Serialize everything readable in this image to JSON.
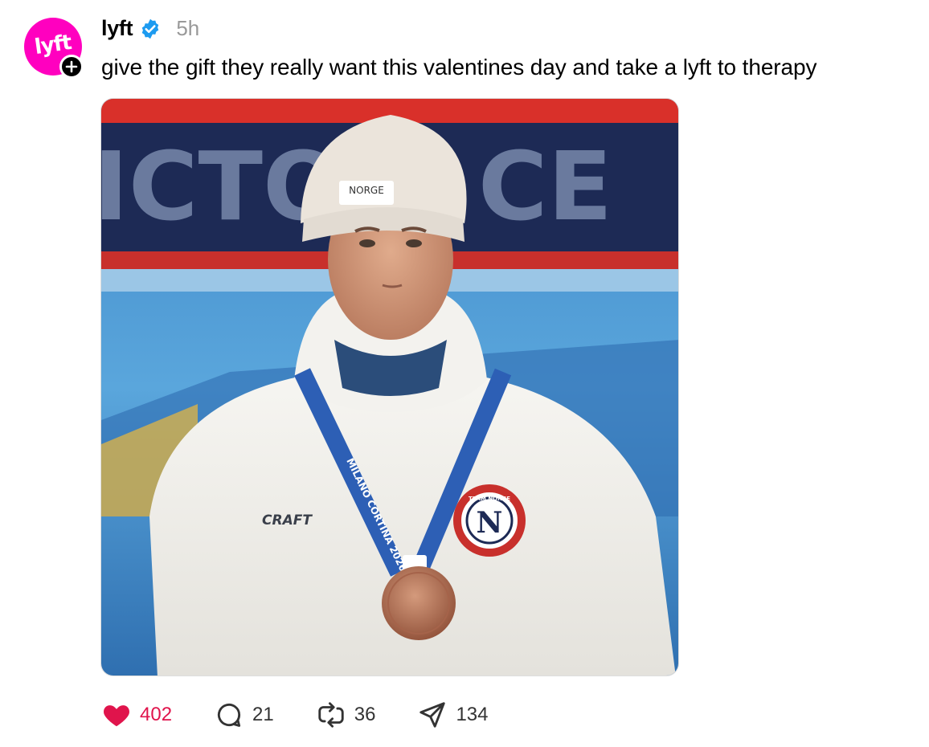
{
  "post": {
    "author": {
      "username": "lyft",
      "avatar_text": "lyft",
      "brand_color": "#ff00bf",
      "verified": true,
      "verified_color": "#1d9bf0"
    },
    "time": "5h",
    "text": "give the gift they really want this valentines day and take a lyft to therapy",
    "image": {
      "banner_text": "ICTO  Y CE",
      "hat_text": "NORGE",
      "jacket_brand": "CRAFT",
      "lanyard_text": "MILANO CORTINA 2026",
      "patch_text": "TEAM NORGE",
      "patch_letter": "N"
    },
    "actions": {
      "likes": "402",
      "comments": "21",
      "reposts": "36",
      "shares": "134",
      "like_color": "#e0144c"
    }
  }
}
